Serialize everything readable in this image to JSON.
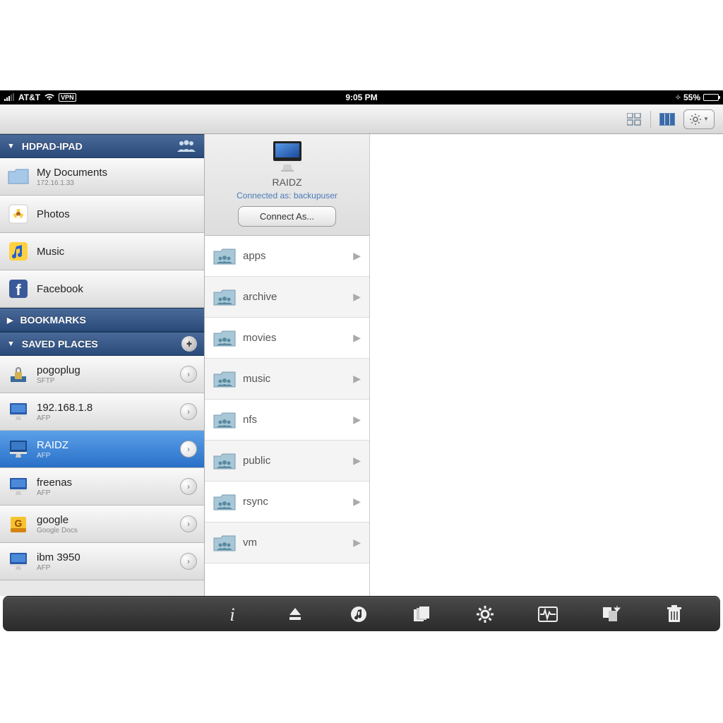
{
  "status": {
    "carrier": "AT&T",
    "vpn": "VPN",
    "time": "9:05 PM",
    "battery_pct": "55%"
  },
  "sidebar": {
    "section1": {
      "title": "HDPAD-IPAD"
    },
    "items1": [
      {
        "label": "My Documents",
        "sublabel": "172.16.1.33"
      },
      {
        "label": "Photos"
      },
      {
        "label": "Music"
      },
      {
        "label": "Facebook"
      }
    ],
    "section2": {
      "title": "BOOKMARKS"
    },
    "section3": {
      "title": "SAVED PLACES"
    },
    "places": [
      {
        "label": "pogoplug",
        "sublabel": "SFTP"
      },
      {
        "label": "192.168.1.8",
        "sublabel": "AFP"
      },
      {
        "label": "RAIDZ",
        "sublabel": "AFP"
      },
      {
        "label": "freenas",
        "sublabel": "AFP"
      },
      {
        "label": "google",
        "sublabel": "Google Docs"
      },
      {
        "label": "ibm 3950",
        "sublabel": "AFP"
      }
    ]
  },
  "server": {
    "name": "RAIDZ",
    "connected_as": "Connected as: backupuser",
    "connect_button": "Connect As..."
  },
  "folders": [
    {
      "name": "apps"
    },
    {
      "name": "archive"
    },
    {
      "name": "movies"
    },
    {
      "name": "music"
    },
    {
      "name": "nfs"
    },
    {
      "name": "public"
    },
    {
      "name": "rsync"
    },
    {
      "name": "vm"
    }
  ]
}
